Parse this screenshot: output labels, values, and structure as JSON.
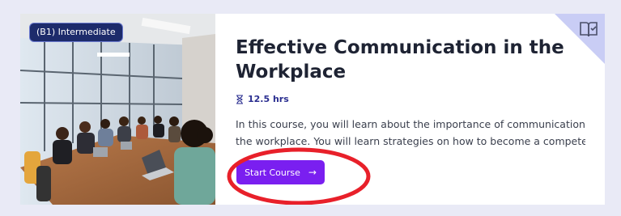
{
  "course": {
    "level": "(B1) Intermediate",
    "title_line1": "Effective Communication in the",
    "title_line2": "Workplace",
    "duration": "12.5 hrs",
    "description_line1": "In this course, you will learn about the importance of communication in",
    "description_line2": "the workplace. You will learn strategies on how to become a competent...",
    "start_label": "Start Course",
    "start_arrow": "→"
  },
  "colors": {
    "accent": "#7a1ff0",
    "badge_bg": "#1d2b6b",
    "corner_bg": "#c9cdf5",
    "annotation": "#e8202a"
  },
  "icons": {
    "bookmark": "book-check-icon",
    "duration": "hourglass-icon",
    "arrow": "arrow-right-icon"
  }
}
